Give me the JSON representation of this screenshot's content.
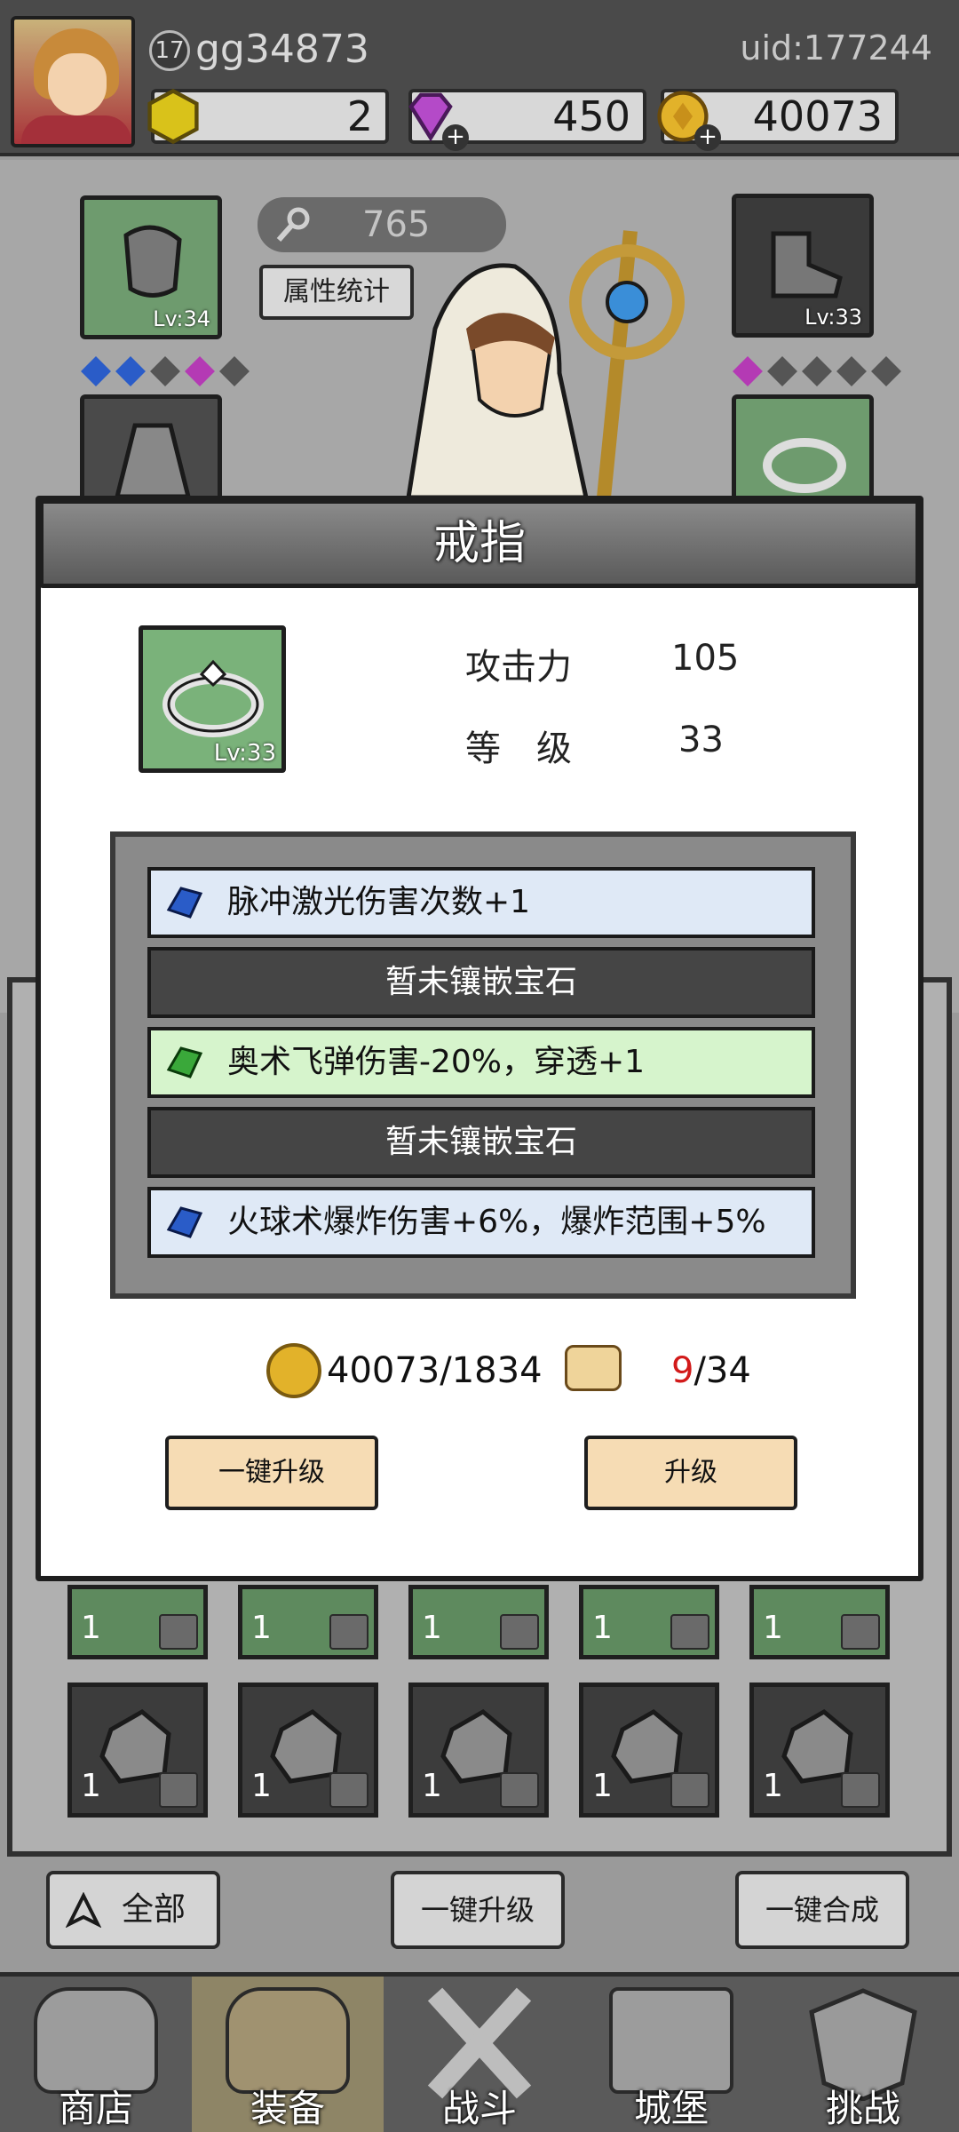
{
  "header": {
    "level": "17",
    "username": "gg34873",
    "uid": "uid:177244",
    "resources": [
      {
        "name": "hex-gem",
        "value": "2"
      },
      {
        "name": "diamond",
        "value": "450"
      },
      {
        "name": "coin",
        "value": "40073"
      }
    ]
  },
  "equip": {
    "power": "765",
    "attr_button": "属性统计",
    "slots": [
      {
        "name": "gauntlet",
        "level": "Lv:34"
      },
      {
        "name": "boot",
        "level": "Lv:33"
      }
    ]
  },
  "modal": {
    "title": "戒指",
    "item_level": "Lv:33",
    "stats": [
      {
        "label": "攻击力",
        "value": "105"
      },
      {
        "label": "等　级",
        "value": "33"
      }
    ],
    "gem_slots": [
      {
        "type": "blue",
        "text": "脉冲激光伤害次数+1"
      },
      {
        "type": "empty",
        "text": "暂未镶嵌宝石"
      },
      {
        "type": "green",
        "text": "奥术飞弹伤害-20%，穿透+1"
      },
      {
        "type": "empty",
        "text": "暂未镶嵌宝石"
      },
      {
        "type": "blue",
        "text": "火球术爆炸伤害+6%，爆炸范围+5%"
      }
    ],
    "coin_cost": "40073/1834",
    "scroll_have": "9",
    "scroll_need": "/34",
    "one_click_upgrade": "一键升级",
    "upgrade": "升级"
  },
  "bag": {
    "row1_count": "1",
    "row2_count": "1"
  },
  "actions": {
    "all": "全部",
    "one_click_upgrade": "一键升级",
    "one_click_merge": "一键合成"
  },
  "nav": [
    {
      "label": "商店"
    },
    {
      "label": "装备"
    },
    {
      "label": "战斗"
    },
    {
      "label": "城堡"
    },
    {
      "label": "挑战"
    }
  ],
  "colors": {
    "accent_red": "#d21a1a",
    "gem_blue": "#2a5cc8",
    "gem_green": "#3aa83a",
    "button_cream": "#f6dcb4"
  }
}
